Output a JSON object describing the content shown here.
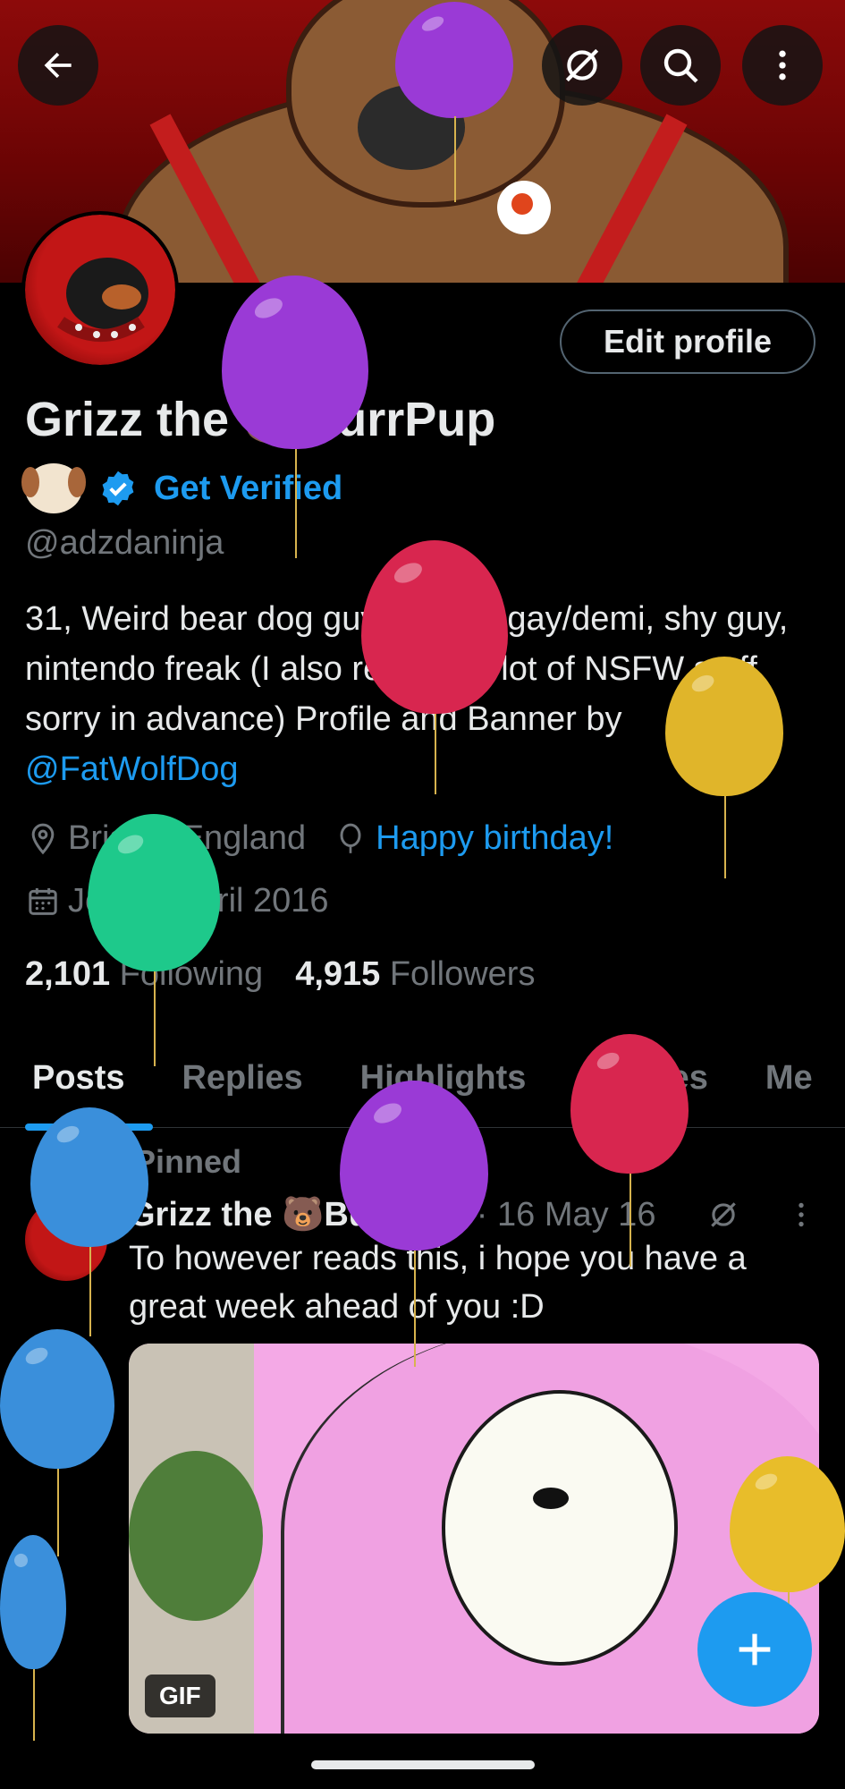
{
  "profile": {
    "display_name": "Grizz the 🐻BurrPup",
    "get_verified": "Get Verified",
    "handle": "@adzdaninja",
    "bio_text": "31, Weird bear dog guy, gamer, gay/demi, shy guy, nintendo freak (I also retweet a lot of NSFW stuff, sorry in advance) Profile and Banner by ",
    "bio_link": "@FatWolfDog",
    "location": "Bristol, England",
    "birthday": "Happy birthday!",
    "joined": "Joined April 2016",
    "following_count": "2,101",
    "following_label": "Following",
    "followers_count": "4,915",
    "followers_label": "Followers",
    "edit_button": "Edit profile"
  },
  "tabs": [
    "Posts",
    "Replies",
    "Highlights",
    "Articles",
    "Me"
  ],
  "post": {
    "pinned_label": "Pinned",
    "author": "Grizz the 🐻BurrPu...",
    "date": "· 16 May 16",
    "text": "To however reads this, i hope you have a great week ahead of you :D",
    "media_badge": "GIF"
  },
  "icons": {
    "back": "back-arrow-icon",
    "no_sync": "sync-off-icon",
    "search": "search-icon",
    "more": "more-vertical-icon",
    "location": "location-pin-icon",
    "balloon": "balloon-icon",
    "calendar": "calendar-icon",
    "pin": "pin-icon",
    "verified": "verified-badge-icon",
    "compose": "plus-icon"
  },
  "colors": {
    "accent": "#1d9bf0",
    "muted": "#71767b",
    "text": "#e7e9ea",
    "background": "#000000"
  }
}
